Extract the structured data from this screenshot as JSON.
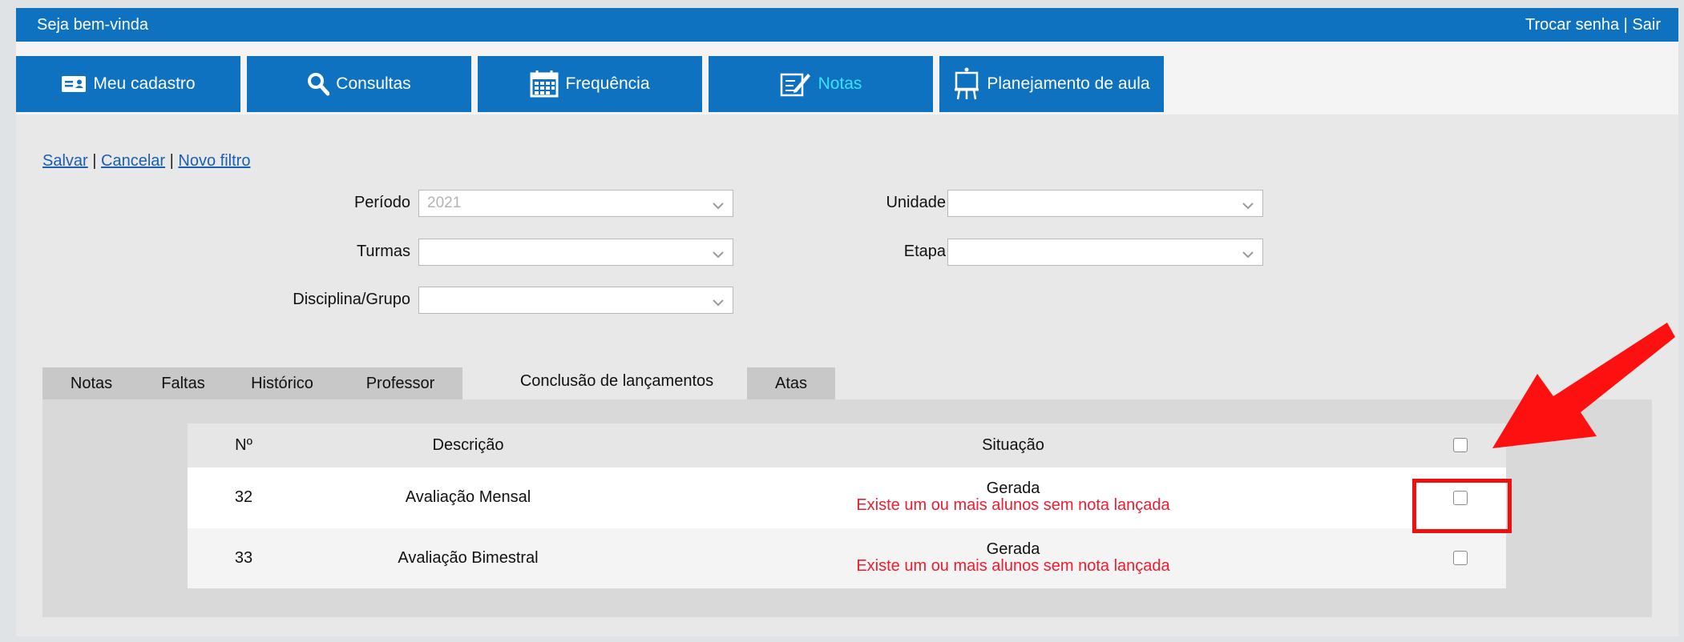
{
  "topbar": {
    "welcome": "Seja bem-vinda",
    "change_password": "Trocar senha",
    "separator": "|",
    "logout": "Sair"
  },
  "nav": {
    "items": [
      {
        "label": "Meu cadastro",
        "icon": "id-card-icon"
      },
      {
        "label": "Consultas",
        "icon": "search-icon"
      },
      {
        "label": "Frequência",
        "icon": "calendar-icon"
      },
      {
        "label": "Notas",
        "icon": "edit-note-icon",
        "active": true
      },
      {
        "label": "Planejamento de aula",
        "icon": "presentation-board-icon"
      }
    ]
  },
  "actions": {
    "save": "Salvar",
    "cancel": "Cancelar",
    "new_filter": "Novo filtro",
    "sep": "|"
  },
  "filters": {
    "periodo": {
      "label": "Período",
      "value": "2021"
    },
    "unidade": {
      "label": "Unidade",
      "value": ""
    },
    "turmas": {
      "label": "Turmas",
      "value": ""
    },
    "etapa": {
      "label": "Etapa",
      "value": ""
    },
    "disciplina": {
      "label": "Disciplina/Grupo",
      "value": ""
    }
  },
  "tabs": [
    {
      "label": "Notas"
    },
    {
      "label": "Faltas"
    },
    {
      "label": "Histórico"
    },
    {
      "label": "Professor"
    },
    {
      "label": "Conclusão de lançamentos",
      "active": true
    },
    {
      "label": "Atas"
    }
  ],
  "table": {
    "headers": {
      "num": "Nº",
      "descricao": "Descrição",
      "situacao": "Situação"
    },
    "rows": [
      {
        "num": "32",
        "descricao": "Avaliação Mensal",
        "status": "Gerada",
        "warning": "Existe um ou mais alunos sem nota lançada",
        "checked": false
      },
      {
        "num": "33",
        "descricao": "Avaliação Bimestral",
        "status": "Gerada",
        "warning": "Existe um ou mais alunos sem nota lançada",
        "checked": false
      }
    ]
  },
  "colors": {
    "brand": "#0e72c0",
    "active_tab_text": "#39e2ff",
    "warning": "#ee1c2e",
    "annotation": "#ee0f0f"
  }
}
